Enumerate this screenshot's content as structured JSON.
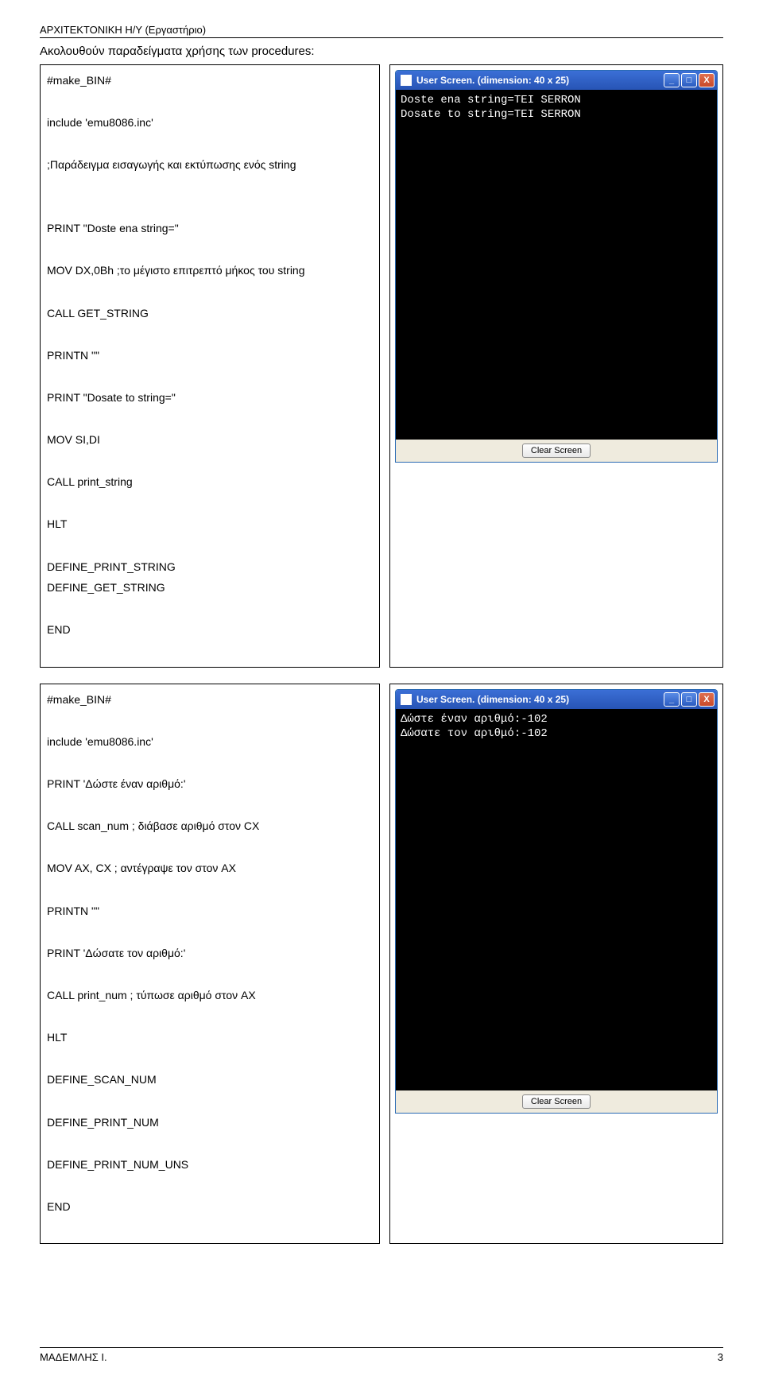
{
  "header": "ΑΡΧΙΤΕΚΤΟΝΙΚΗ Η/Υ (Εργαστήριο)",
  "intro": "Ακολουθούν παραδείγματα χρήσης των procedures:",
  "ex1": {
    "code": [
      "#make_BIN#",
      "",
      "include 'emu8086.inc'",
      "",
      ";Παράδειγμα εισαγωγής και εκτύπωσης ενός string",
      "",
      "",
      "PRINT \"Doste ena string=\"",
      "",
      "MOV DX,0Bh  ;το μέγιστο επιτρεπτό μήκος του string",
      "",
      "CALL GET_STRING",
      "",
      "PRINTN \"\"",
      "",
      "PRINT \"Dosate to string=\"",
      "",
      "MOV SI,DI",
      "",
      "CALL print_string",
      "",
      "HLT",
      "",
      "DEFINE_PRINT_STRING",
      "DEFINE_GET_STRING",
      "",
      "END",
      ""
    ],
    "screen": {
      "title": "User Screen. (dimension: 40 x 25)",
      "lines": [
        "Doste ena string=TEI SERRON",
        "Dosate to string=TEI SERRON"
      ],
      "clear": "Clear Screen"
    }
  },
  "ex2": {
    "code": [
      "#make_BIN#",
      "",
      "include 'emu8086.inc'",
      "",
      "PRINT 'Δώστε έναν αριθμό:'",
      "",
      "CALL   scan_num        ; διάβασε αριθμό στον CX",
      "",
      "MOV    AX, CX          ; αντέγραψε τον στον AX",
      "",
      "PRINTN \"\"",
      "",
      "PRINT 'Δώσατε τον αριθμό:'",
      "",
      "CALL   print_num       ; τύπωσε αριθμό στον AX",
      "",
      "HLT",
      "",
      "DEFINE_SCAN_NUM",
      "",
      "DEFINE_PRINT_NUM",
      "",
      "DEFINE_PRINT_NUM_UNS",
      "",
      "END",
      ""
    ],
    "screen": {
      "title": "User Screen. (dimension: 40 x 25)",
      "lines": [
        "Δώστε έναν αριθμό:-102",
        "Δώσατε τον αριθμό:-102"
      ],
      "clear": "Clear Screen"
    }
  },
  "footer": {
    "left": "ΜΑΔΕΜΛΗΣ Ι.",
    "right": "3"
  }
}
